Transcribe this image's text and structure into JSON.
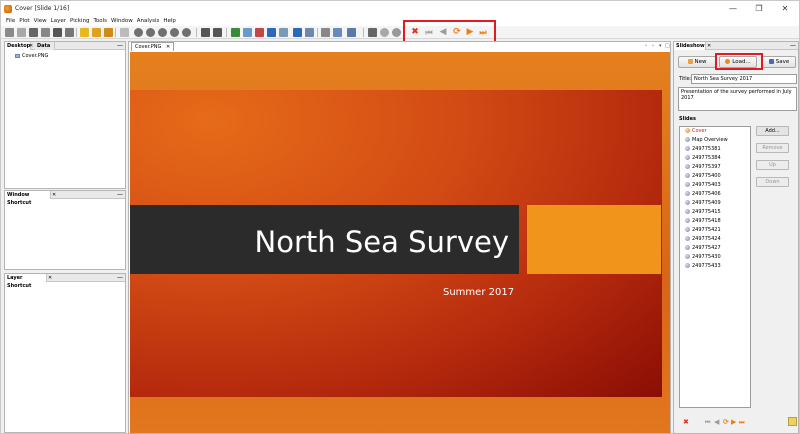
{
  "window": {
    "title": "Cover [Slide 1/16]",
    "controls": [
      "—",
      "❐",
      "✕"
    ]
  },
  "menu": [
    "File",
    "Plot",
    "View",
    "Layer",
    "Picking",
    "Tools",
    "Window",
    "Analysis",
    "Help"
  ],
  "toolbar": {
    "icons": [
      "pointer-icon",
      "grid-icon",
      "layers-icon",
      "table-icon",
      "folder-icon",
      "camera-icon",
      "zoom-in-icon",
      "zoom-out-icon",
      "pan-icon",
      "chart-icon",
      "settings-icon",
      "color-icon",
      "globe-icon",
      "key-icon",
      "bulb-icon"
    ],
    "slideshow_controls": {
      "stop": "✖",
      "first": "⏮",
      "previous": "◀",
      "loop": "⟳",
      "play": "▶",
      "last": "⏭"
    },
    "colors": {
      "stop": "#e0321a",
      "nav": "#9c9c9c",
      "play": "#f07d10"
    }
  },
  "panels": {
    "desktop": {
      "tabs": [
        "Desktop",
        "Data"
      ],
      "items": [
        "Cover.PNG"
      ]
    },
    "window_shortcut": {
      "title": "Window Shortcut"
    },
    "layer_shortcut": {
      "title": "Layer Shortcut"
    }
  },
  "document": {
    "tab_label": "Cover.PNG",
    "nav": [
      "‹",
      "›",
      "▾",
      "□"
    ],
    "slide": {
      "title": "North Sea Survey",
      "subtitle": "Summer 2017"
    }
  },
  "slideshow": {
    "panel_title": "Slideshow",
    "buttons": {
      "new": "New",
      "load": "Load...",
      "save": "Save"
    },
    "title_label": "Title:",
    "title_value": "North Sea Survey 2017",
    "description": "Presentation of the survey performed in July 2017",
    "slides_label": "Slides",
    "slides": [
      "Cover",
      "Map Overview",
      "249775381",
      "249775384",
      "249775397",
      "249775400",
      "249775403",
      "249775406",
      "249775409",
      "249775415",
      "249775418",
      "249775421",
      "249775424",
      "249775427",
      "249775430",
      "249775433"
    ],
    "side_buttons": {
      "add": "Add...",
      "remove": "Remove",
      "up": "Up",
      "down": "Down"
    }
  }
}
